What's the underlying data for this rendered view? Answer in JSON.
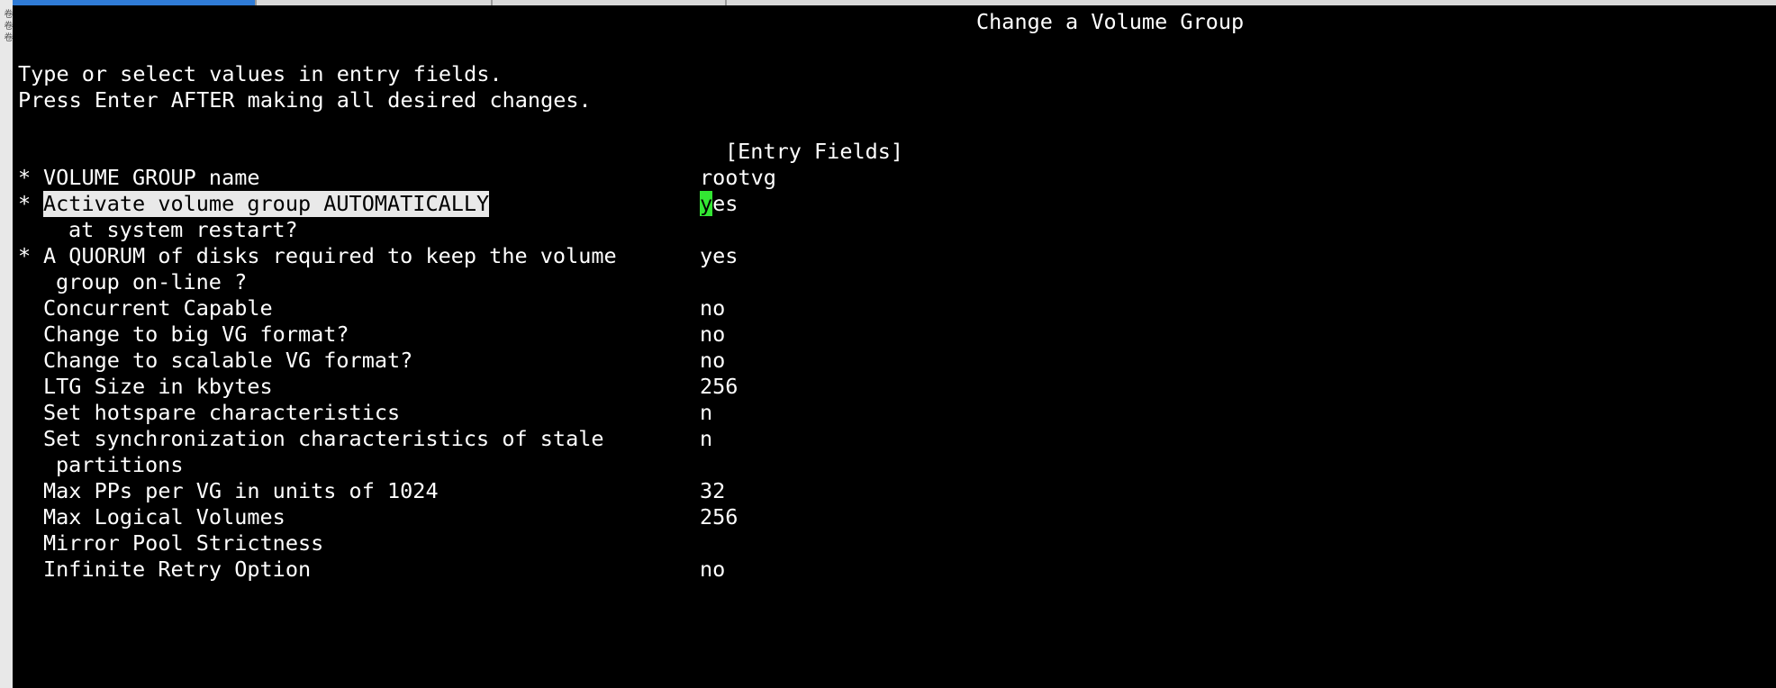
{
  "app": {
    "gutter_text": "卷 卷 卷"
  },
  "screen": {
    "title": "Change a Volume Group",
    "instructions": [
      "Type or select values in entry fields.",
      "Press Enter AFTER making all desired changes."
    ],
    "entry_fields_header": "[Entry Fields]"
  },
  "fields": [
    {
      "required": "*",
      "label": "VOLUME GROUP name",
      "value": "rootvg"
    },
    {
      "required": "*",
      "label": "Activate volume group AUTOMATICALLY",
      "continuation": "at system restart?",
      "value_cursor": "y",
      "value_rest": "es",
      "selected": true
    },
    {
      "required": "*",
      "label": "A QUORUM of disks required to keep the volume",
      "continuation": "group on-line ?",
      "value": "yes"
    },
    {
      "required": "",
      "label": "Concurrent Capable",
      "value": "no"
    },
    {
      "required": "",
      "label": "Change to big VG format?",
      "value": "no"
    },
    {
      "required": "",
      "label": "Change to scalable VG format?",
      "value": "no"
    },
    {
      "required": "",
      "label": "LTG Size in kbytes",
      "value": "256"
    },
    {
      "required": "",
      "label": "Set hotspare characteristics",
      "value": "n"
    },
    {
      "required": "",
      "label": "Set synchronization characteristics of stale",
      "continuation": "partitions",
      "value": "n"
    },
    {
      "required": "",
      "label": "Max PPs per VG in units of 1024",
      "value": "32"
    },
    {
      "required": "",
      "label": "Max Logical Volumes",
      "value": "256"
    },
    {
      "required": "",
      "label": "Mirror Pool Strictness",
      "value": ""
    },
    {
      "required": "",
      "label": "Infinite Retry Option",
      "value": "no"
    }
  ],
  "colors": {
    "background": "#000000",
    "text": "#ffffff",
    "selection": "#e9e9e9",
    "cursor": "#33e633",
    "active_tab": "#2f7bd6"
  }
}
